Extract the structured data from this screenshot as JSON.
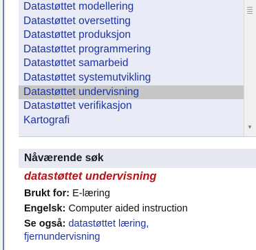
{
  "list": {
    "items": [
      "Datastøttet modellering",
      "Datastøttet oversetting",
      "Datastøttet produksjon",
      "Datastøttet programmering",
      "Datastøttet samarbeid",
      "Datastøttet systemutvikling",
      "Datastøttet undervisning",
      "Datastøttet verifikasjon",
      "Kartografi"
    ],
    "selected_index": 6
  },
  "detail": {
    "header": "Nåværende søk",
    "term": "datastøttet undervisning",
    "used_for_label": "Brukt for:",
    "used_for_value": "E-læring",
    "english_label": "Engelsk:",
    "english_value": "Computer aided instruction",
    "see_also_label": "Se også:",
    "see_also_links": [
      "datastøttet læring,",
      "fjernundervisning"
    ]
  },
  "colors": {
    "link": "#1d33a3",
    "term": "#b5141a",
    "selected_row": "#c6c6c6",
    "list_background": "#e9ecf6"
  }
}
